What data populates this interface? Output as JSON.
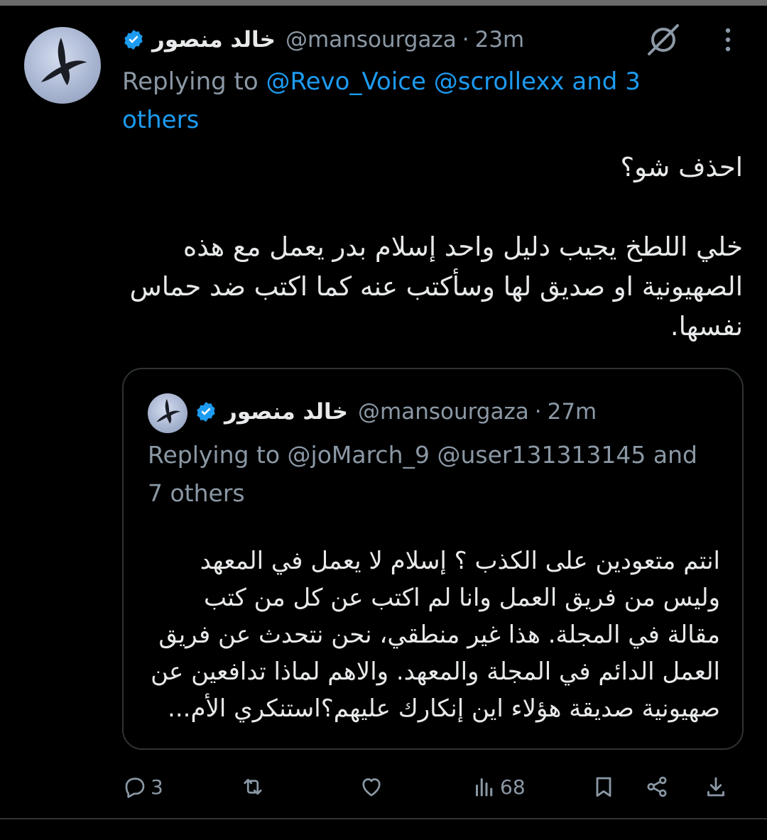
{
  "tweet": {
    "author": {
      "display_name": "خالد منصور",
      "handle": "@mansourgaza",
      "time": "23m",
      "separator": "·"
    },
    "replying_prefix": "Replying to",
    "replying_mentions": "@Revo_Voice @scrollexx and 3 others",
    "text": "احذف شو؟\n\nخلي اللطخ يجيب دليل واحد إسلام بدر يعمل مع هذه الصهيونية او صديق لها وسأكتب عنه كما اكتب ضد حماس نفسها."
  },
  "quoted_tweet": {
    "author": {
      "display_name": "خالد منصور",
      "handle": "@mansourgaza",
      "time": "27m",
      "separator": "·"
    },
    "replying_line": "Replying to @joMarch_9 @user131313145 and 7 others",
    "text": "انتم متعودين على الكذب ؟ إسلام لا يعمل في المعهد وليس من فريق العمل وانا لم اكتب عن كل من كتب مقالة في المجلة. هذا غير منطقي، نحن نتحدث عن فريق العمل الدائم في المجلة والمعهد. والاهم لماذا تدافعين عن صهيونية صديقة هؤلاء اين إنكارك عليهم؟استنكري الأم..."
  },
  "actions": {
    "reply_count": "3",
    "retweet_count": "",
    "like_count": "",
    "views_count": "68"
  },
  "icons": {
    "avatar": "bird-silhouette-avatar",
    "verified": "verified-badge-icon",
    "grok": "grok-icon",
    "more": "more-vertical-icon",
    "reply": "reply-icon",
    "retweet": "retweet-icon",
    "like": "like-icon",
    "views": "views-icon",
    "bookmark": "bookmark-icon",
    "share": "share-icon",
    "download": "download-icon"
  },
  "colors": {
    "background": "#000000",
    "text": "#e7e9ea",
    "secondary": "#8b98a5",
    "link": "#1d9bf0",
    "border": "#2f3336"
  }
}
